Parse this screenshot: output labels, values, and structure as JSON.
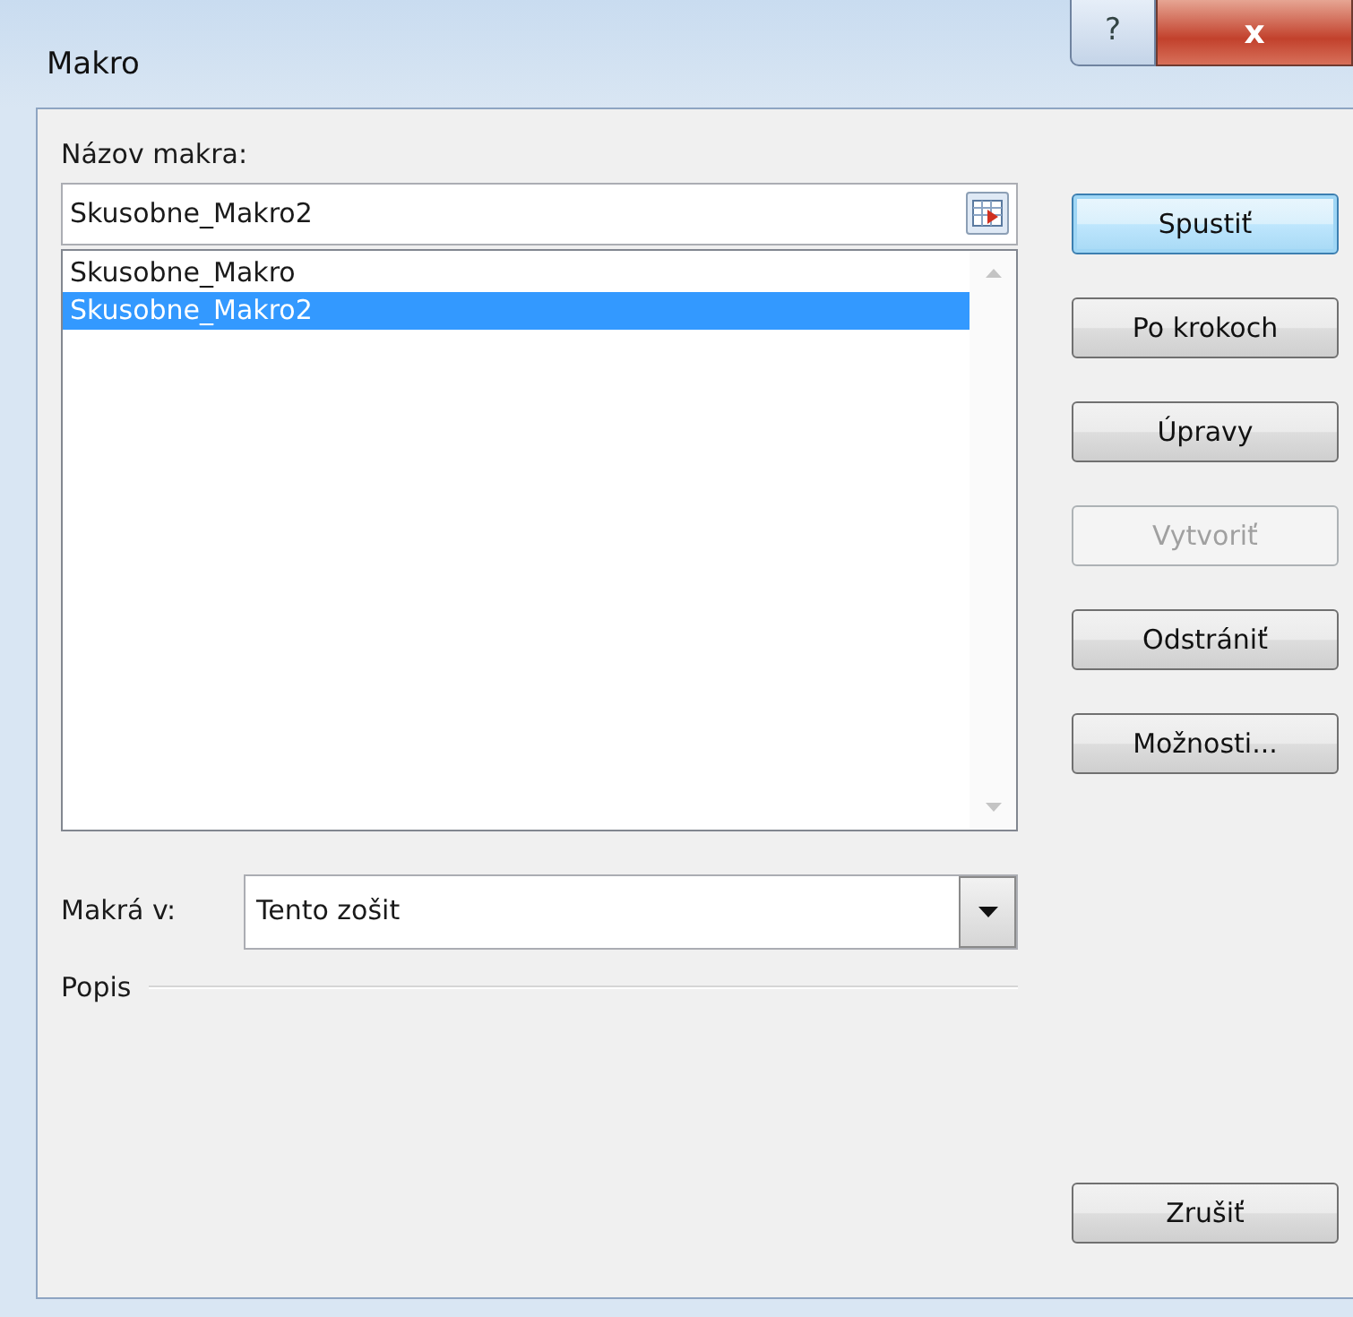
{
  "window": {
    "title": "Makro",
    "help_button": "?",
    "close_button": "x"
  },
  "macro_name": {
    "label": "Názov makra:",
    "value": "Skusobne_Makro2"
  },
  "macros": [
    {
      "name": "Skusobne_Makro",
      "selected": false
    },
    {
      "name": "Skusobne_Makro2",
      "selected": true
    }
  ],
  "buttons": [
    {
      "label": "Spustiť",
      "kind": "default",
      "disabled": false
    },
    {
      "label": "Po krokoch",
      "kind": "normal",
      "disabled": false
    },
    {
      "label": "Úpravy",
      "kind": "normal",
      "disabled": false
    },
    {
      "label": "Vytvoriť",
      "kind": "normal",
      "disabled": true
    },
    {
      "label": "Odstrániť",
      "kind": "normal",
      "disabled": false
    },
    {
      "label": "Možnosti...",
      "kind": "normal",
      "disabled": false
    }
  ],
  "macros_in": {
    "label": "Makrá v:",
    "value": "Tento zošit"
  },
  "description": {
    "label": "Popis"
  },
  "cancel_button": "Zrušiť"
}
